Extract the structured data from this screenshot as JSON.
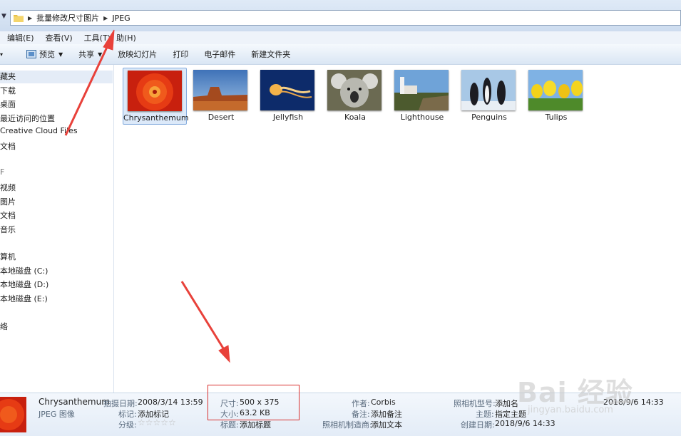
{
  "address": {
    "breadcrumbs": [
      "批量修改尺寸图片",
      "JPEG"
    ]
  },
  "menu": {
    "items": [
      "编辑(E)",
      "查看(V)",
      "工具(T)",
      "助(H)"
    ]
  },
  "toolbar": {
    "preview_label": "预览",
    "share_label": "共享",
    "slideshow_label": "放映幻灯片",
    "print_label": "打印",
    "email_label": "电子邮件",
    "new_folder_label": "新建文件夹"
  },
  "nav": {
    "favorites": "藏夹",
    "downloads": "下载",
    "desktop": "桌面",
    "recent": "最近访问的位置",
    "creative_cloud": "Creative Cloud Files",
    "documents_fav": "文档",
    "libraries_mark": "F",
    "videos": "视频",
    "pictures": "图片",
    "documents": "文档",
    "music": "音乐",
    "computer": "算机",
    "drive_c": "本地磁盘 (C:)",
    "drive_d": "本地磁盘 (D:)",
    "drive_e": "本地磁盘 (E:)",
    "network": "络"
  },
  "files": [
    {
      "name": "Chrysanthemum",
      "selected": true
    },
    {
      "name": "Desert",
      "selected": false
    },
    {
      "name": "Jellyfish",
      "selected": false
    },
    {
      "name": "Koala",
      "selected": false
    },
    {
      "name": "Lighthouse",
      "selected": false
    },
    {
      "name": "Penguins",
      "selected": false
    },
    {
      "name": "Tulips",
      "selected": false
    }
  ],
  "details": {
    "filename": "Chrysanthemum",
    "filetype": "JPEG 图像",
    "date_taken_label": "拍摄日期:",
    "date_taken": "2008/3/14 13:59",
    "tags_label": "标记:",
    "tags_value": "添加标记",
    "rating_label": "分级:",
    "rating": 0,
    "dimensions_label": "尺寸:",
    "dimensions": "500 x 375",
    "size_label": "大小:",
    "size": "63.2 KB",
    "title_label": "标题:",
    "title_value": "添加标题",
    "author_label": "作者:",
    "author": "Corbis",
    "comments_label": "备注:",
    "comments_value": "添加备注",
    "maker_label": "照相机制造商:",
    "maker_value": "添加文本",
    "model_label": "照相机型号:",
    "model_value": "添加名",
    "subject_label": "主题:",
    "subject_value": "指定主题",
    "modified_value": "2018/9/6 14:33",
    "created_label": "创建日期:",
    "created_value": "2018/9/6 14:33"
  },
  "watermark": {
    "text": "Bai 经验",
    "sub": "jingyan.baidu.com"
  },
  "colors": {
    "accent_red": "#d8302e",
    "selection": "#dce9f9"
  }
}
